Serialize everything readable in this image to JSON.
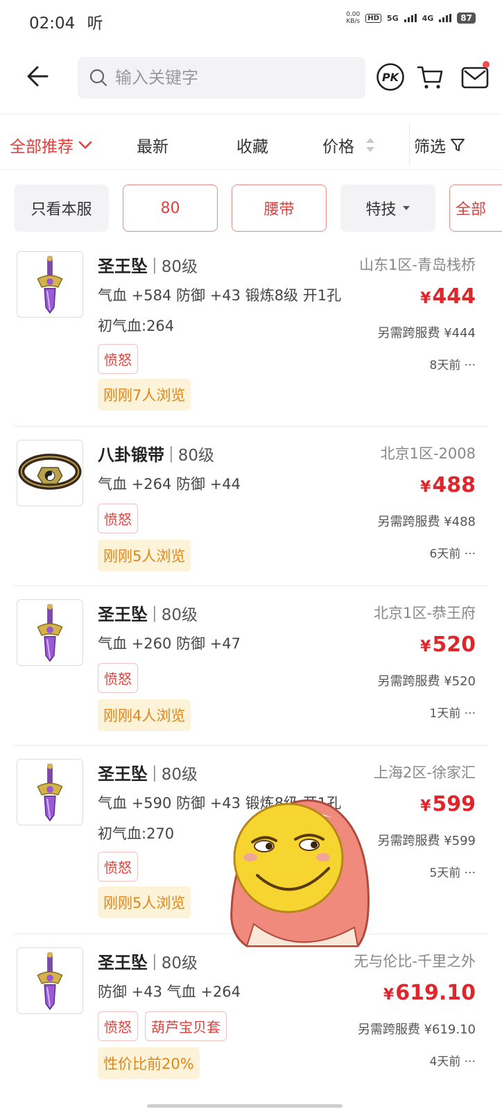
{
  "status_bar": {
    "time": "02:04",
    "extra": "听",
    "net_speed_value": "0.00",
    "net_speed_unit": "KB/s",
    "hd": "HD",
    "sig1": "5G",
    "sig2": "4G",
    "battery": "87"
  },
  "search": {
    "placeholder": "输入关键字"
  },
  "top_actions": {
    "pk_label": "PK"
  },
  "sort": {
    "recommend": "全部推荐",
    "newest": "最新",
    "favorite": "收藏",
    "price": "价格",
    "filter": "筛选"
  },
  "chips": [
    {
      "label": "只看本服"
    },
    {
      "label": "80"
    },
    {
      "label": "腰带"
    },
    {
      "label": "特技"
    },
    {
      "label": "全部"
    }
  ],
  "items": [
    {
      "name": "圣王坠",
      "level": "80级",
      "server": "山东1区-青岛栈桥",
      "stats": "气血 +584 防御 +43 锻炼8级 开1孔",
      "extra": "初气血:264",
      "price_currency": "¥",
      "price": "444",
      "fee": "另需跨服费 ¥444",
      "tags": [
        "愤怒"
      ],
      "views": "刚刚7人浏览",
      "time": "8天前",
      "icon": "pendant-icon"
    },
    {
      "name": "八卦锻带",
      "level": "80级",
      "server": "北京1区-2008",
      "stats": "气血 +264 防御 +44",
      "extra": "",
      "price_currency": "¥",
      "price": "488",
      "fee": "另需跨服费 ¥488",
      "tags": [
        "愤怒"
      ],
      "views": "刚刚5人浏览",
      "time": "6天前",
      "icon": "belt-icon"
    },
    {
      "name": "圣王坠",
      "level": "80级",
      "server": "北京1区-恭王府",
      "stats": "气血 +260 防御 +47",
      "extra": "",
      "price_currency": "¥",
      "price": "520",
      "fee": "另需跨服费 ¥520",
      "tags": [
        "愤怒"
      ],
      "views": "刚刚4人浏览",
      "time": "1天前",
      "icon": "pendant-icon"
    },
    {
      "name": "圣王坠",
      "level": "80级",
      "server": "上海2区-徐家汇",
      "stats": "气血 +590 防御 +43 锻炼8级 开1孔",
      "extra": "初气血:270",
      "price_currency": "¥",
      "price": "599",
      "fee": "另需跨服费 ¥599",
      "tags": [
        "愤怒"
      ],
      "views": "刚刚5人浏览",
      "time": "5天前",
      "icon": "pendant-icon"
    },
    {
      "name": "圣王坠",
      "level": "80级",
      "server": "无与伦比-千里之外",
      "stats": "防御 +43 气血 +264",
      "extra": "",
      "price_currency": "¥",
      "price": "619.10",
      "fee": "另需跨服费 ¥619.10",
      "tags": [
        "愤怒",
        "葫芦宝贝套"
      ],
      "views": "性价比前20%",
      "time": "4天前",
      "icon": "pendant-icon"
    }
  ],
  "more_glyph": "···"
}
